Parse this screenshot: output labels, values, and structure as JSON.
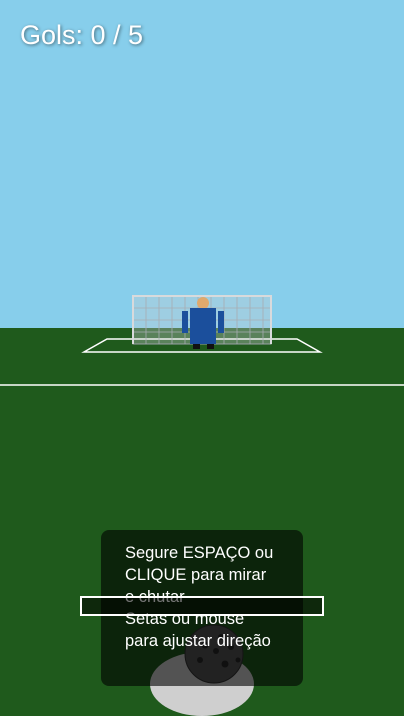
{
  "hud": {
    "score_label": "Gols:",
    "goals": 0,
    "total_shots": 5,
    "score_text": "Gols: 0 / 5"
  },
  "instructions": {
    "line1": "Segure ESPAÇO ou CLIQUE para mirar e chutar",
    "line2": "Setas ou mouse para ajustar direção"
  },
  "power_meter": {
    "fill_fraction": 0.0
  },
  "colors": {
    "sky": "#87ceeb",
    "grass": "#1f5a1c",
    "field_lines": "#ffffff",
    "goalkeeper_shirt": "#1b4f9c",
    "goalkeeper_skin": "#e0a96d",
    "net": "#9aa0a6",
    "ball": "#555555"
  }
}
